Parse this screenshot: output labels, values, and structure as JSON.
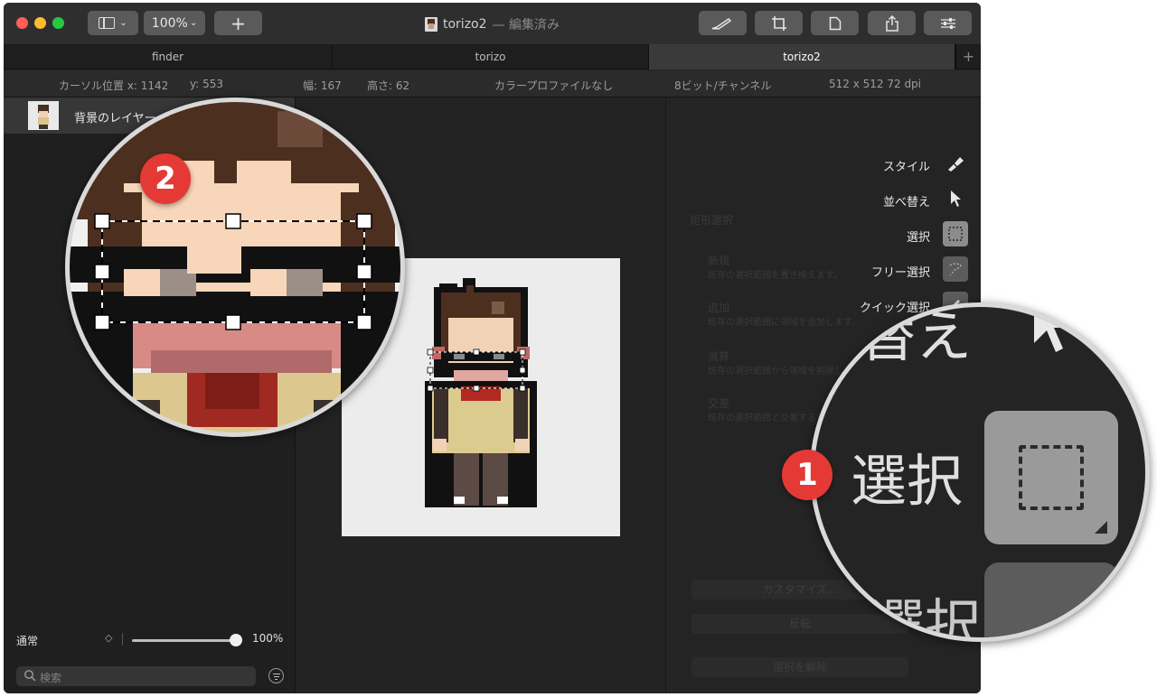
{
  "window": {
    "title": "torizo2",
    "title_status": "— 編集済み",
    "zoom_label": "100%",
    "add_label": "+"
  },
  "tabs": [
    {
      "label": "finder",
      "active": false
    },
    {
      "label": "torizo",
      "active": false
    },
    {
      "label": "torizo2",
      "active": true
    }
  ],
  "tab_add_label": "+",
  "infobar": {
    "cursor": "カーソル位置 x: 1142",
    "cursor_y": "y: 553",
    "width": "幅: 167",
    "height": "高さ: 62",
    "color_profile": "カラープロファイルなし",
    "bit_depth": "8ビット/チャンネル",
    "size": "512 x 512 72 dpi"
  },
  "layers": {
    "items": [
      {
        "label": "背景のレイヤー"
      }
    ],
    "blend_mode": "通常",
    "stepper": "◇",
    "opacity": "100%",
    "opacity_value": 1.0,
    "search_placeholder": "検索"
  },
  "tools": [
    {
      "label": "スタイル",
      "icon": "brush-icon"
    },
    {
      "label": "並べ替え",
      "icon": "arrow-icon"
    },
    {
      "label": "選択",
      "icon": "rect-select-icon"
    },
    {
      "label": "フリー選択",
      "icon": "lasso-icon"
    },
    {
      "label": "クイック選択",
      "icon": "quick-select-icon"
    }
  ],
  "selection_panel": {
    "heading": "矩形選択",
    "options": [
      {
        "label": "新規",
        "desc": "既存の選択範囲を置き換えます。"
      },
      {
        "label": "追加",
        "desc": "既存の選択範囲に領域を追加します。"
      },
      {
        "label": "減算",
        "desc": "既存の選択範囲から領域を削除します。"
      },
      {
        "label": "交差",
        "desc": "既存の選択範囲と交差する領域を選択します。"
      }
    ],
    "buttons": [
      "カスタマイズ...",
      "反転",
      "選択を解除"
    ]
  },
  "callouts": {
    "badge1": "1",
    "badge2": "2",
    "lens1_text_top": "替え",
    "lens1_label": "選択",
    "lens1_text_bottom": "選択"
  },
  "colors": {
    "badge": "#e53935",
    "close": "#fe5f57",
    "minimize": "#febc2e",
    "zoom": "#28c840"
  }
}
